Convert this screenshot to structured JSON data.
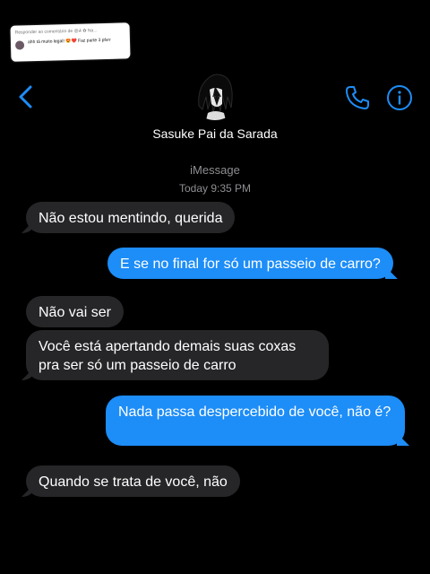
{
  "comment": {
    "header": "Responder ao comentário de @-̶̸̶͛-  ✿ Na...",
    "text": "ahh tá muito legal! 😍❤️ Faz parte 3 pfvrr"
  },
  "header": {
    "contact_name": "Sasuke Pai da Sarada",
    "icons": {
      "back": "chevron-left-icon",
      "phone": "phone-icon",
      "info": "info-icon"
    },
    "accent_color": "#1d8df7"
  },
  "conversation": {
    "service": "iMessage",
    "timestamp": "Today 9:35 PM",
    "messages": [
      {
        "from": "them",
        "text": "Não estou mentindo, querida"
      },
      {
        "from": "me",
        "text": "E se no final for só um passeio de carro?"
      },
      {
        "from": "them",
        "text": "Não vai ser"
      },
      {
        "from": "them",
        "text": "Você está apertando demais suas coxas pra ser só um passeio de carro"
      },
      {
        "from": "me",
        "text": "Nada passa despercebido de você, não é?"
      },
      {
        "from": "them",
        "text": "Quando se trata de você, não"
      }
    ]
  },
  "colors": {
    "received_bubble": "#262629",
    "sent_bubble": "#1d8df7",
    "background": "#000000"
  }
}
